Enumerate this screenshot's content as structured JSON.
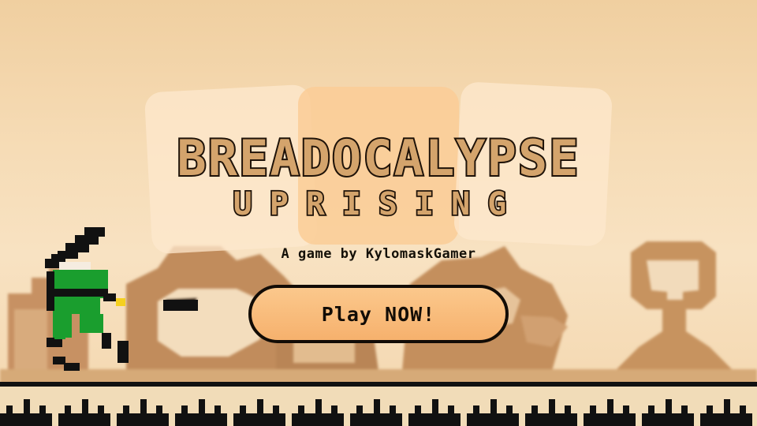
{
  "title": {
    "main": "BREADOCALYPSE",
    "sub": "UPRISING"
  },
  "byline": "A game by KylomaskGamer",
  "play_button_label": "Play NOW!",
  "colors": {
    "sky": "#f6dcb6",
    "title_fill": "#d4a46c",
    "outline": "#1e1208",
    "button_fill": "#f6b16d",
    "player_green": "#1a9e2e",
    "ground_stripe": "#f1dcb8"
  },
  "icons": [
    "player-sprite",
    "bread-character-sprites",
    "ground-tiles"
  ]
}
